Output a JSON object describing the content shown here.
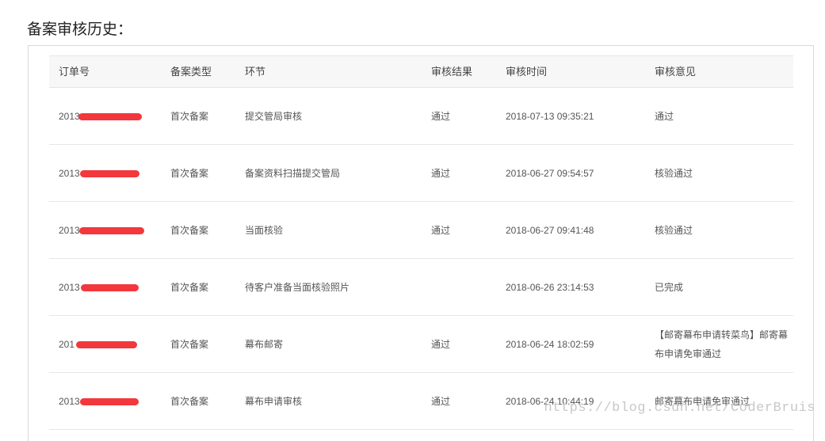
{
  "page": {
    "title": "备案审核历史："
  },
  "table": {
    "headers": [
      "订单号",
      "备案类型",
      "环节",
      "审核结果",
      "审核时间",
      "审核意见"
    ],
    "rows": [
      {
        "order": "2013",
        "type": "首次备案",
        "step": "提交管局审核",
        "result": "通过",
        "time": "2018-07-13 09:35:21",
        "opinion": "通过"
      },
      {
        "order": "2013",
        "type": "首次备案",
        "step": "备案资料扫描提交管局",
        "result": "通过",
        "time": "2018-06-27 09:54:57",
        "opinion": "核验通过"
      },
      {
        "order": "2013",
        "type": "首次备案",
        "step": "当面核验",
        "result": "通过",
        "time": "2018-06-27 09:41:48",
        "opinion": "核验通过"
      },
      {
        "order": "2013",
        "type": "首次备案",
        "step": "待客户准备当面核验照片",
        "result": "",
        "time": "2018-06-26 23:14:53",
        "opinion": "已完成"
      },
      {
        "order": "201",
        "type": "首次备案",
        "step": "幕布邮寄",
        "result": "通过",
        "time": "2018-06-24 18:02:59",
        "opinion": "【邮寄幕布申请转菜鸟】邮寄幕布申请免审通过"
      },
      {
        "order": "2013",
        "type": "首次备案",
        "step": "幕布申请审核",
        "result": "通过",
        "time": "2018-06-24 10:44:19",
        "opinion": "邮寄幕布申请免审通过"
      }
    ]
  },
  "watermark": "https://blog.csdn.net/CoderBruis",
  "colors": {
    "redaction": "#f2383c",
    "header_bg": "#f7f7f7",
    "border": "#e6e6e6"
  }
}
